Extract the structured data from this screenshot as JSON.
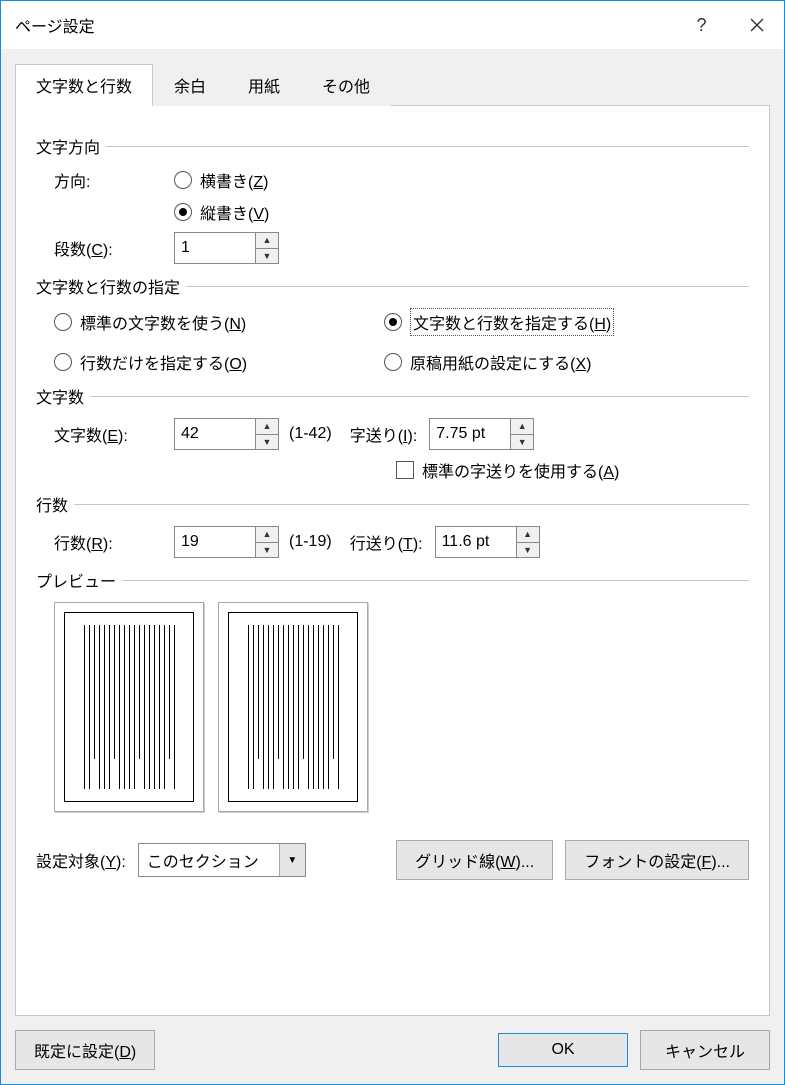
{
  "dialog": {
    "title": "ページ設定"
  },
  "tabs": {
    "t1": "文字数と行数",
    "t2": "余白",
    "t3": "用紙",
    "t4": "その他"
  },
  "textdir": {
    "group": "文字方向",
    "label": "方向:",
    "horiz_pre": "横書き(",
    "horiz_key": "Z",
    "horiz_post": ")",
    "vert_pre": "縦書き(",
    "vert_key": "V",
    "vert_post": ")",
    "cols_pre": "段数(",
    "cols_key": "C",
    "cols_post": "):",
    "cols_val": "1"
  },
  "spec": {
    "group": "文字数と行数の指定",
    "opt1_pre": "標準の文字数を使う(",
    "opt1_key": "N",
    "opt1_post": ")",
    "opt2_pre": "文字数と行数を指定する(",
    "opt2_key": "H",
    "opt2_post": ")",
    "opt3_pre": "行数だけを指定する(",
    "opt3_key": "O",
    "opt3_post": ")",
    "opt4_pre": "原稿用紙の設定にする(",
    "opt4_key": "X",
    "opt4_post": ")"
  },
  "chars": {
    "group": "文字数",
    "count_pre": "文字数(",
    "count_key": "E",
    "count_post": "):",
    "count_val": "42",
    "count_range": "(1-42)",
    "pitch_pre": "字送り(",
    "pitch_key": "I",
    "pitch_post": "):",
    "pitch_val": "7.75 pt",
    "stdpitch_pre": "標準の字送りを使用する(",
    "stdpitch_key": "A",
    "stdpitch_post": ")"
  },
  "lines": {
    "group": "行数",
    "count_pre": "行数(",
    "count_key": "R",
    "count_post": "):",
    "count_val": "19",
    "count_range": "(1-19)",
    "pitch_pre": "行送り(",
    "pitch_key": "T",
    "pitch_post": "):",
    "pitch_val": "11.6 pt"
  },
  "preview": {
    "group": "プレビュー"
  },
  "apply": {
    "label_pre": "設定対象(",
    "label_key": "Y",
    "label_post": "):",
    "value": "このセクション",
    "grid_pre": "グリッド線(",
    "grid_key": "W",
    "grid_post": ")...",
    "font_pre": "フォントの設定(",
    "font_key": "F",
    "font_post": ")..."
  },
  "footer": {
    "default_pre": "既定に設定(",
    "default_key": "D",
    "default_post": ")",
    "ok": "OK",
    "cancel": "キャンセル"
  }
}
